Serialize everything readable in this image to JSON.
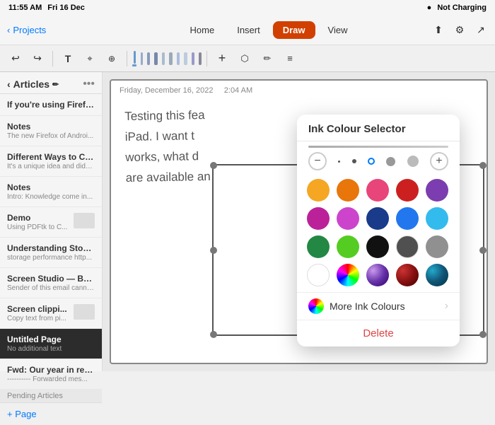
{
  "status": {
    "time": "11:55 AM",
    "day": "Fri 16 Dec",
    "wifi": "Not Charging",
    "battery": "⚡"
  },
  "nav": {
    "back_label": "Projects",
    "tabs": [
      "Home",
      "Insert",
      "Draw",
      "View"
    ],
    "active_tab": "Draw"
  },
  "toolbar": {
    "undo": "↩",
    "redo": "↪",
    "text": "T",
    "lasso": "⌖",
    "plus_alt": "⊕",
    "more": "⋯",
    "share_icon": "⬆",
    "settings_icon": "⚙",
    "export_icon": "↗"
  },
  "sidebar": {
    "title": "Articles",
    "items": [
      {
        "title": "If you're using Firefox for And...",
        "sub": "",
        "has_thumb": false
      },
      {
        "title": "Notes",
        "sub": "The new Firefox of Androi...",
        "has_thumb": false
      },
      {
        "title": "Different Ways to Capt...",
        "sub": "It's a unique idea and didn't fi...",
        "has_thumb": false
      },
      {
        "title": "Notes",
        "sub": "Intro:  Knowledge come in...",
        "has_thumb": false
      },
      {
        "title": "Demo",
        "sub": "Using PDFtk to C...",
        "has_thumb": true
      },
      {
        "title": "Understanding Stora...",
        "sub": "storage performance  http...",
        "has_thumb": false
      },
      {
        "title": "Screen Studio — Be...",
        "sub": "Sender of this email canno...",
        "has_thumb": false
      },
      {
        "title": "Screen clippi...",
        "sub": "Copy text from pi...",
        "has_thumb": true
      },
      {
        "title": "Untitled Page",
        "sub": "No additional text",
        "has_thumb": false,
        "active": true
      },
      {
        "title": "Fwd: Our year in revi...",
        "sub": "---------- Forwarded mes...",
        "has_thumb": false
      }
    ],
    "section_label": "Pending Articles",
    "footer_label": "+ Page"
  },
  "page": {
    "date": "Friday, December 16, 2022",
    "time": "2:04 AM",
    "content_lines": [
      "Testing this fea",
      "iPad.  I want t",
      "works, what d",
      "are available an"
    ]
  },
  "ink_selector": {
    "title": "Ink Colour Selector",
    "line_preview": "—",
    "sizes": [
      "−",
      "·",
      "·",
      "○",
      "●",
      "●",
      "+"
    ],
    "colors": [
      "#F5A623",
      "#E8760A",
      "#E8457A",
      "#CC2020",
      "#7B3DB0",
      "#BB2299",
      "#CC44CC",
      "#1A3A8A",
      "#2277EE",
      "#33BBEE",
      "#228844",
      "#55CC22",
      "#111111",
      "#606060",
      "#909090",
      "#FFFFFF",
      "#C8A060",
      "#9966CC",
      "#993333",
      "#226688"
    ],
    "special_colors": [
      "rainbow",
      "gold-glitter",
      "lavender-glitter",
      "dark-red-glitter",
      "teal-galaxy"
    ],
    "more_label": "More Ink Colours",
    "delete_label": "Delete"
  }
}
